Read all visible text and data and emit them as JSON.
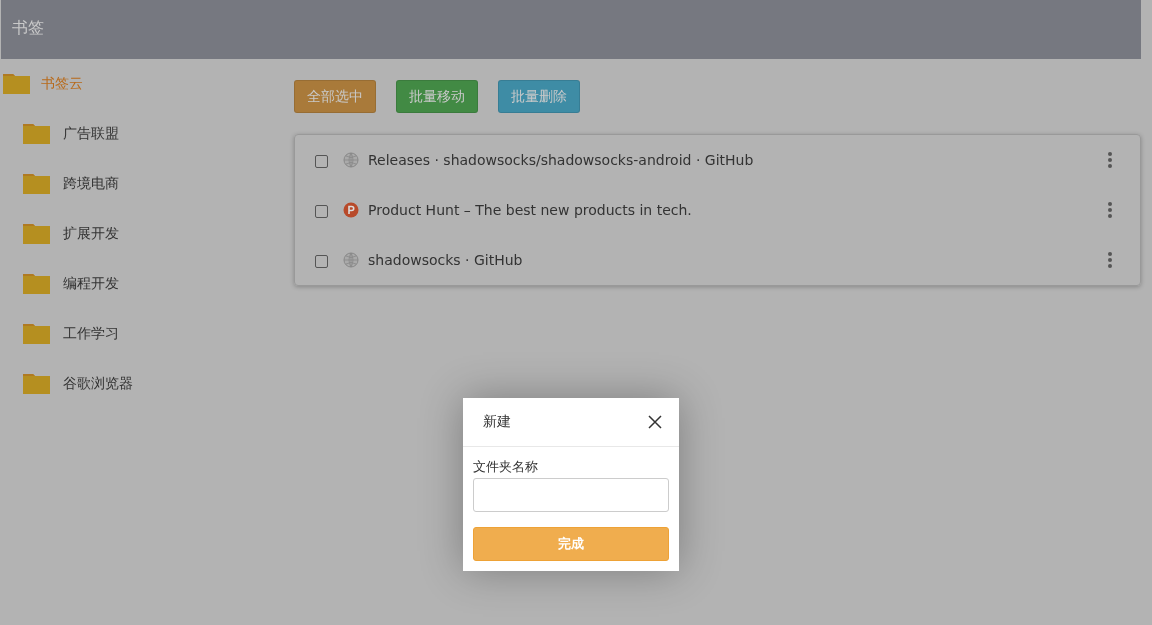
{
  "header": {
    "title": "书签"
  },
  "sidebar": {
    "folders": [
      {
        "label": "书签云",
        "selected": true,
        "children": [
          {
            "label": "广告联盟",
            "selected": false
          },
          {
            "label": "跨境电商",
            "selected": false
          },
          {
            "label": "扩展开发",
            "selected": false
          },
          {
            "label": "编程开发",
            "selected": false
          },
          {
            "label": "工作学习",
            "selected": false
          },
          {
            "label": "谷歌浏览器",
            "selected": false
          }
        ]
      }
    ]
  },
  "toolbar": {
    "buttons": [
      {
        "label": "全部选中",
        "kind": "warning"
      },
      {
        "label": "批量移动",
        "kind": "success"
      },
      {
        "label": "批量删除",
        "kind": "info"
      }
    ]
  },
  "bookmarks": [
    {
      "title": "Releases · shadowsocks/shadowsocks-android · GitHub",
      "checked": false,
      "kind": "globe"
    },
    {
      "title": "Product Hunt – The best new products in tech.",
      "checked": false,
      "kind": "producthunt"
    },
    {
      "title": "shadowsocks · GitHub",
      "checked": false,
      "kind": "globe"
    }
  ],
  "dialog": {
    "title": "新建",
    "field_label": "文件夹名称",
    "submit": "完成"
  }
}
